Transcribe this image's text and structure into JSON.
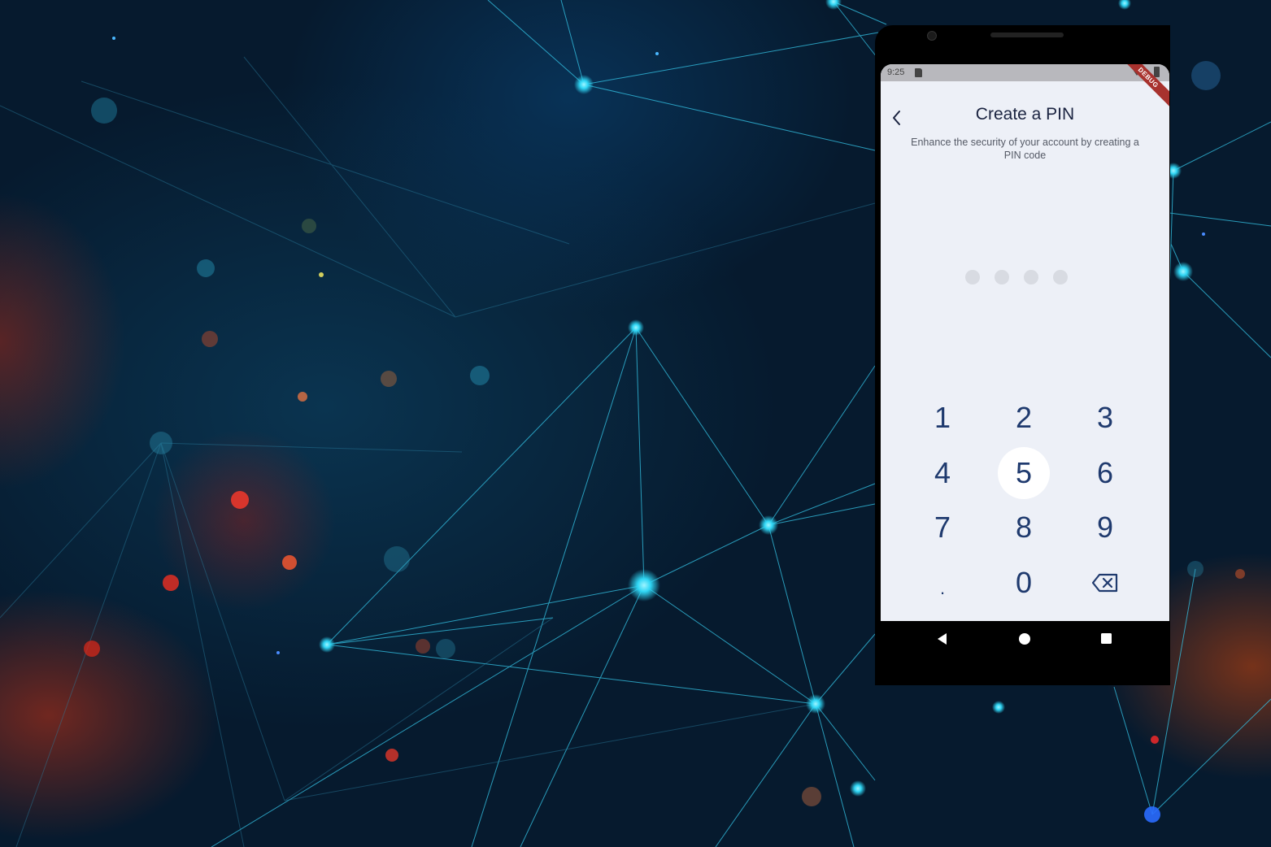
{
  "status_bar": {
    "time": "9:25",
    "debug_label": "DEBUG"
  },
  "header": {
    "back_icon": "chevron-left-icon",
    "title": "Create a PIN",
    "subtitle": "Enhance the security of your account by creating a PIN code"
  },
  "pin": {
    "length": 4,
    "filled": 0
  },
  "keypad": {
    "keys": [
      "1",
      "2",
      "3",
      "4",
      "5",
      "6",
      "7",
      "8",
      "9",
      ".",
      "0"
    ],
    "pressed_key": "5",
    "delete_icon": "backspace-icon"
  },
  "nav_bar": {
    "back_icon": "triangle-back-icon",
    "home_icon": "circle-home-icon",
    "recents_icon": "square-recents-icon"
  },
  "colors": {
    "accent": "#1f3a6e",
    "screen_background": "#edf0f7",
    "pin_dot": "#d8dbe2",
    "debug_ribbon": "#a8322e"
  }
}
